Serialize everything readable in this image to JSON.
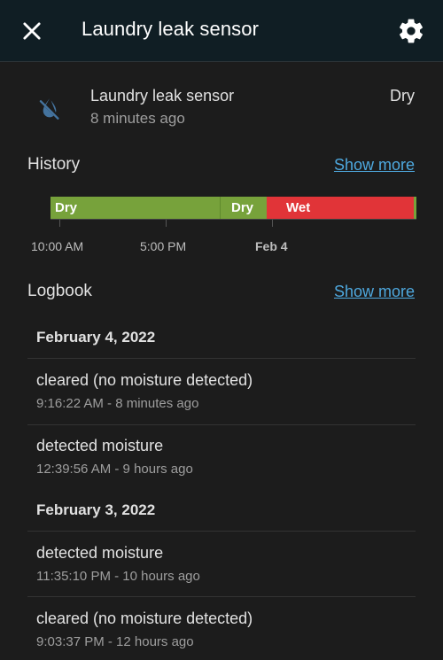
{
  "header": {
    "title": "Laundry leak sensor"
  },
  "entity": {
    "name": "Laundry leak sensor",
    "last_changed": "8 minutes ago",
    "state": "Dry",
    "icon": "water-off-icon"
  },
  "history": {
    "title": "History",
    "show_more": "Show more",
    "segments": [
      {
        "label": "Dry",
        "state": "dry",
        "color": "#77a23b"
      },
      {
        "label": "Dry",
        "state": "dry",
        "color": "#77a23b"
      },
      {
        "label": "Wet",
        "state": "wet",
        "color": "#e13438"
      }
    ],
    "axis_labels": [
      "10:00 AM",
      "5:00 PM",
      "Feb 4"
    ]
  },
  "logbook": {
    "title": "Logbook",
    "show_more": "Show more",
    "groups": [
      {
        "date": "February 4, 2022",
        "entries": [
          {
            "message": "cleared (no moisture detected)",
            "time": "9:16:22 AM - 8 minutes ago"
          },
          {
            "message": "detected moisture",
            "time": "12:39:56 AM - 9 hours ago"
          }
        ]
      },
      {
        "date": "February 3, 2022",
        "entries": [
          {
            "message": "detected moisture",
            "time": "11:35:10 PM - 10 hours ago"
          },
          {
            "message": "cleared (no moisture detected)",
            "time": "9:03:37 PM - 12 hours ago"
          }
        ]
      }
    ]
  }
}
